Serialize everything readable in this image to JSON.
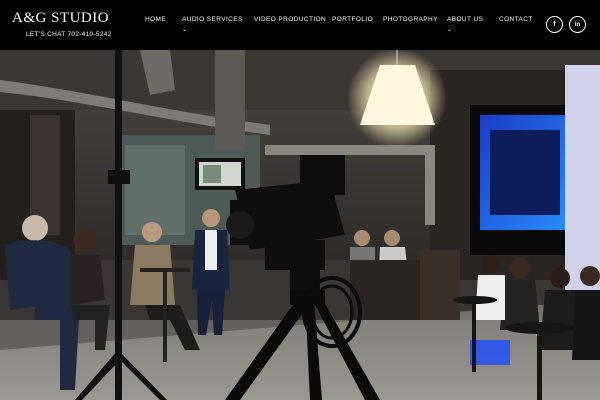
{
  "logo": {
    "title": "A&G STUDIO",
    "phone": "LET'S CHAT 702-410-5242"
  },
  "nav": [
    {
      "label": "HOME",
      "has_dropdown": false
    },
    {
      "label": "AUDIO SERVICES",
      "has_dropdown": true
    },
    {
      "label": "VIDEO PRODUCTION",
      "has_dropdown": false
    },
    {
      "label": "PORTFOLIO",
      "has_dropdown": false
    },
    {
      "label": "PHOTOGRAPHY",
      "has_dropdown": false
    },
    {
      "label": "ABOUT US",
      "has_dropdown": true
    },
    {
      "label": "CONTACT",
      "has_dropdown": false
    }
  ],
  "social": [
    {
      "icon": "facebook-icon",
      "glyph": "f"
    },
    {
      "icon": "linkedin-icon",
      "glyph": "in"
    }
  ],
  "hero": {
    "description_icon": "studio-camera-photo"
  },
  "colors": {
    "header_bg": "#000000",
    "text": "#ffffff",
    "accent_blue": "#2a6cff"
  }
}
